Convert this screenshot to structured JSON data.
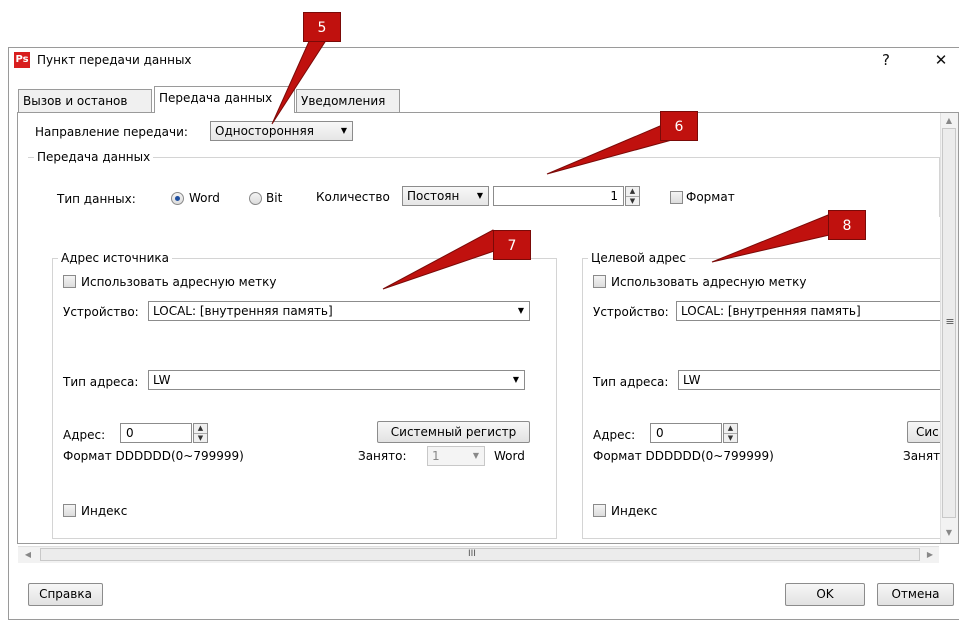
{
  "window": {
    "title": "Пункт передачи данных",
    "logo_text": "Ps",
    "help_glyph": "?",
    "close_glyph": "✕"
  },
  "tabs": [
    {
      "label": "Вызов и останов"
    },
    {
      "label": "Передача данных"
    },
    {
      "label": "Уведомления"
    }
  ],
  "direction": {
    "label": "Направление передачи:",
    "value": "Односторонняя"
  },
  "transfer_group": {
    "title": "Передача данных",
    "data_type_label": "Тип данных:",
    "word_label": "Word",
    "bit_label": "Bit",
    "selected_type": "Word",
    "quantity_label": "Количество",
    "quantity_mode": "Постоян",
    "quantity_value": "1",
    "format_label": "Формат"
  },
  "source": {
    "title": "Адрес источника",
    "use_tag_label": "Использовать адресную метку",
    "device_label": "Устройство:",
    "device_value": "LOCAL: [внутренняя память]",
    "addr_type_label": "Тип адреса:",
    "addr_type_value": "LW",
    "address_label": "Адрес:",
    "address_value": "0",
    "format_text": "Формат DDDDDD(0~799999)",
    "sysreg_button": "Системный регистр",
    "occupied_label": "Занято:",
    "occupied_value": "1",
    "occupied_unit": "Word",
    "index_label": "Индекс"
  },
  "target": {
    "title": "Целевой адрес",
    "use_tag_label": "Использовать адресную метку",
    "device_label": "Устройство:",
    "device_value": "LOCAL: [внутренняя память]",
    "addr_type_label": "Тип адреса:",
    "addr_type_value": "LW",
    "address_label": "Адрес:",
    "address_value": "0",
    "format_text": "Формат DDDDDD(0~799999)",
    "sysreg_button_partial": "Сис",
    "occupied_partial": "Занят",
    "index_label": "Индекс"
  },
  "scrollbar": {
    "h_grip": "III",
    "v_grip": "≡"
  },
  "footer": {
    "help_button": "Справка",
    "ok_button": "OK",
    "cancel_button": "Отмена"
  },
  "callouts": [
    "5",
    "6",
    "7",
    "8"
  ],
  "colors": {
    "callout": "#c0110e",
    "logo": "#d81e1e",
    "radio_dot": "#1f4fa0"
  }
}
